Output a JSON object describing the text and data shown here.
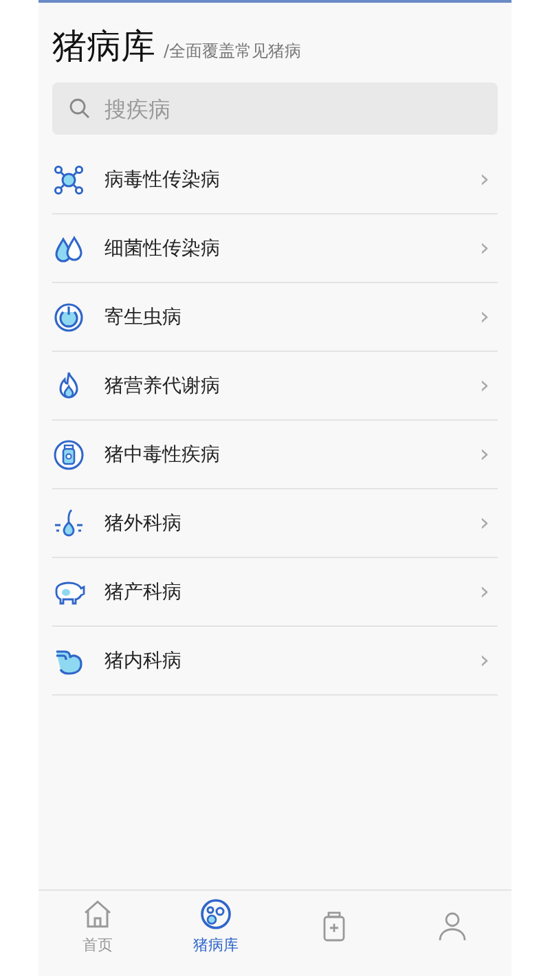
{
  "header": {
    "title": "猪病库",
    "subtitle": "/全面覆盖常见猪病"
  },
  "search": {
    "placeholder": "搜疾病"
  },
  "categories": [
    {
      "kind": "virus",
      "label": "病毒性传染病",
      "chevron": "›"
    },
    {
      "kind": "drops",
      "label": "细菌性传染病",
      "chevron": "›"
    },
    {
      "kind": "ring",
      "label": "寄生虫病",
      "chevron": "›"
    },
    {
      "kind": "flame",
      "label": "猪营养代谢病",
      "chevron": "›"
    },
    {
      "kind": "bottle",
      "label": "猪中毒性疾病",
      "chevron": "›"
    },
    {
      "kind": "hair",
      "label": "猪外科病",
      "chevron": "›"
    },
    {
      "kind": "pig",
      "label": "猪产科病",
      "chevron": "›"
    },
    {
      "kind": "stomach",
      "label": "猪内科病",
      "chevron": "›"
    }
  ],
  "tab_bar": [
    {
      "kind": "home",
      "label": "首页",
      "selected": false
    },
    {
      "kind": "cells",
      "label": "猪病库",
      "selected": true
    },
    {
      "kind": "jar",
      "selected": false
    },
    {
      "kind": "person",
      "selected": false
    }
  ]
}
